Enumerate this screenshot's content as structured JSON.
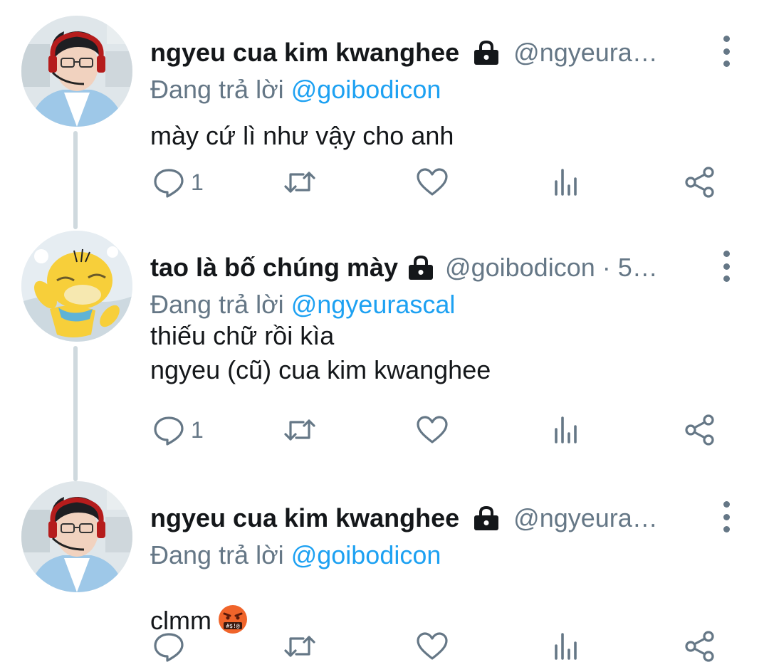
{
  "tweets": [
    {
      "name": "ngyeu cua kim kwanghee",
      "handle": "@ngyeura…",
      "reply_prefix": "Đang trả lời",
      "reply_to": "@goibodicon",
      "text": "mày cứ lì như vậy cho anh",
      "reply_count": "1",
      "avatar": "streamer-avatar"
    },
    {
      "name": "tao là bố chúng mày",
      "handle": "@goibodicon · 5…",
      "reply_prefix": "Đang trả lời",
      "reply_to": "@ngyeurascal",
      "text": "thiếu chữ rồi kìa\nngyeu (cũ) cua kim kwanghee",
      "reply_count": "1",
      "avatar": "psyduck-avatar"
    },
    {
      "name": "ngyeu cua kim kwanghee",
      "handle": "@ngyeura…",
      "reply_prefix": "Đang trả lời",
      "reply_to": "@goibodicon",
      "text": "clmm",
      "reply_count": "",
      "avatar": "streamer-avatar",
      "emoji": "cursing-face-emoji"
    }
  ],
  "icons": {
    "reply": "reply-icon",
    "retweet": "retweet-icon",
    "like": "like-icon",
    "views": "views-icon",
    "share": "share-icon",
    "lock": "lock-icon",
    "more": "more-options-icon"
  },
  "colors": {
    "text": "#14171a",
    "secondary": "#657786",
    "link": "#1da1f2",
    "thread_line": "#cfd9de"
  }
}
